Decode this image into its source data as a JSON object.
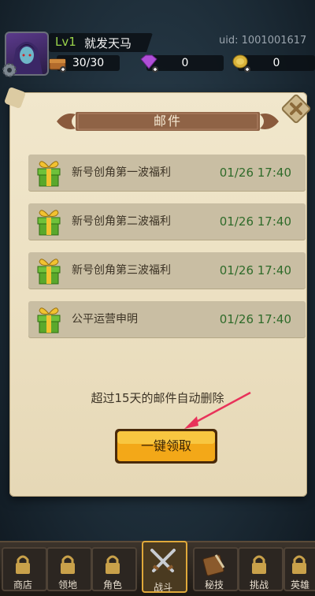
{
  "player": {
    "level": "Lv1",
    "name": "就发天马",
    "uid": "uid:  1001001617"
  },
  "resources": {
    "stamina": "30/30",
    "gems": "0",
    "coins": "0"
  },
  "dialog": {
    "title": "邮件",
    "mails": [
      {
        "subject": "新号创角第一波福利",
        "date": "01/26 17:40"
      },
      {
        "subject": "新号创角第二波福利",
        "date": "01/26 17:40"
      },
      {
        "subject": "新号创角第三波福利",
        "date": "01/26 17:40"
      },
      {
        "subject": "公平运营申明",
        "date": "01/26 17:40"
      }
    ],
    "note": "超过15天的邮件自动删除",
    "claim_all_label": "一键领取"
  },
  "bottom_tabs": [
    {
      "label": "商店",
      "icon": "lock-icon"
    },
    {
      "label": "领地",
      "icon": "lock-icon"
    },
    {
      "label": "角色",
      "icon": "lock-icon"
    },
    {
      "label": "战斗",
      "icon": "crossed-swords-icon",
      "active": true
    },
    {
      "label": "秘技",
      "icon": "spellbook-icon"
    },
    {
      "label": "挑战",
      "icon": "lock-icon"
    },
    {
      "label": "英雄",
      "icon": "lock-icon"
    }
  ],
  "colors": {
    "level_green": "#9ad34a",
    "date_green": "#2f6b2a",
    "title_brown": "#8a5a3c",
    "claim_orange": "#f3a818"
  }
}
